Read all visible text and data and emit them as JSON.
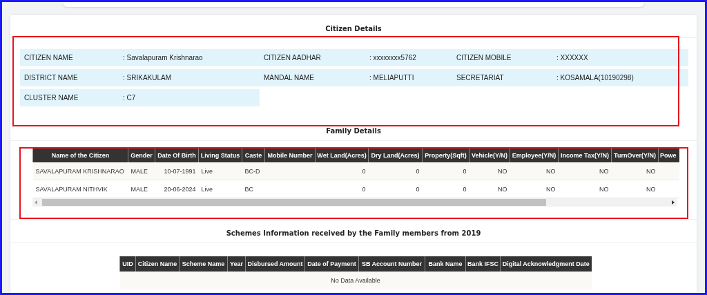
{
  "citizen_details": {
    "title": "Citizen Details",
    "fields": [
      {
        "label": "CITIZEN NAME",
        "value": ": Savalapuram Krishnarao"
      },
      {
        "label": "CITIZEN AADHAR",
        "value": ": xxxxxxxx5762"
      },
      {
        "label": "CITIZEN MOBILE",
        "value": ": XXXXXX"
      },
      {
        "label": "DISTRICT NAME",
        "value": ": SRIKAKULAM"
      },
      {
        "label": "MANDAL NAME",
        "value": ": MELIAPUTTI"
      },
      {
        "label": "SECRETARIAT",
        "value": ": KOSAMALA(10190298)"
      },
      {
        "label": "CLUSTER NAME",
        "value": ": C7"
      }
    ]
  },
  "family_details": {
    "title": "Family Details",
    "columns": [
      "Name of the Citizen",
      "Gender",
      "Date Of Birth",
      "Living Status",
      "Caste",
      "Mobile Number",
      "Wet Land(Acres)",
      "Dry Land(Acres)",
      "Property(Sqft)",
      "Vehicle(Y/N)",
      "Employee(Y/N)",
      "Income Tax(Y/N)",
      "TurnOver(Y/N)",
      "Powe"
    ],
    "rows": [
      {
        "cells": [
          "SAVALAPURAM KRISHNARAO",
          "MALE",
          "10-07-1991",
          "Live",
          "BC-D",
          "",
          "0",
          "0",
          "0",
          "NO",
          "NO",
          "NO",
          "NO"
        ]
      },
      {
        "cells": [
          "SAVALAPURAM NITHVIK",
          "MALE",
          "20-06-2024",
          "Live",
          "BC",
          "",
          "0",
          "0",
          "0",
          "NO",
          "NO",
          "NO",
          "NO"
        ]
      }
    ]
  },
  "schemes": {
    "title": "Schemes Information received by the Family members from 2019",
    "columns": [
      "UID",
      "Citizen Name",
      "Scheme Name",
      "Year",
      "Disbursed Amount",
      "Date of Payment",
      "SB Account Number",
      "Bank Name",
      "Bank IFSC",
      "Digital Acknowledgment Date"
    ],
    "empty_message": "No Data Available"
  }
}
